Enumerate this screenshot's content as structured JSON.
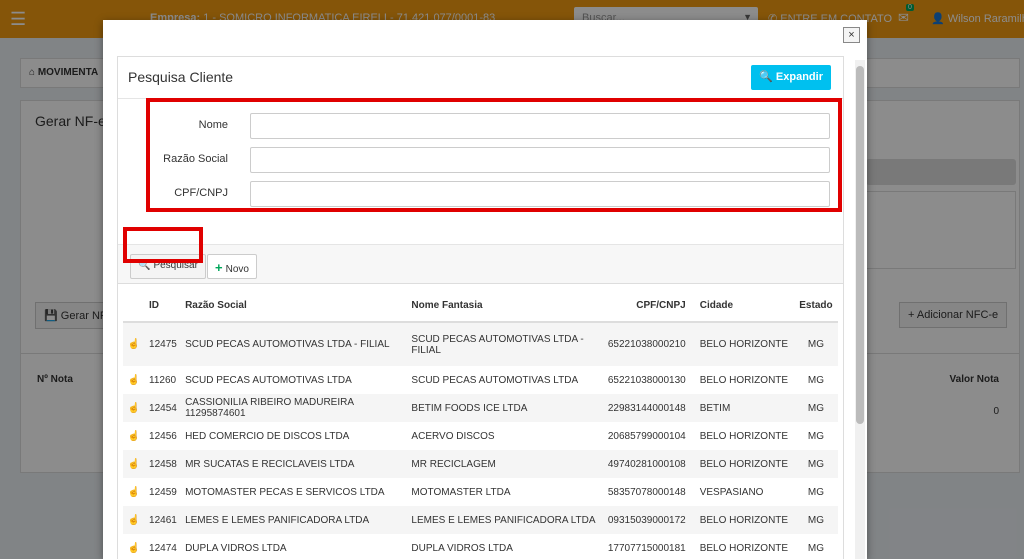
{
  "topbar": {
    "empresa_label": "Empresa:",
    "empresa_value": "1 - SOMICRO INFORMATICA EIRELI - 71.421.077/0001-83",
    "search_placeholder": "Buscar...",
    "contato": "ENTRE EM CONTATO",
    "notif_count": "0",
    "user": "Wilson Raramilho"
  },
  "background": {
    "breadcrumb": "MOVIMENTA",
    "box_title": "Gerar NF-e a",
    "btn_gerar": "Gerar NF-",
    "btn_add": "Adicionar NFC-e",
    "col_nnota": "Nº Nota",
    "col_valor": "Valor Nota",
    "valor_zero": "0"
  },
  "modal": {
    "close_label": "×",
    "title": "Pesquisa Cliente",
    "btn_expandir": "Expandir",
    "fields": {
      "nome_label": "Nome",
      "razao_label": "Razão Social",
      "cpf_label": "CPF/CNPJ"
    },
    "btn_pesquisar": "Pesquisar",
    "btn_novo": "Novo",
    "table": {
      "headers": {
        "id": "ID",
        "razao": "Razão Social",
        "fantasia": "Nome Fantasia",
        "cpf": "CPF/CNPJ",
        "cidade": "Cidade",
        "estado": "Estado"
      },
      "rows": [
        {
          "id": "12475",
          "razao": "SCUD PECAS AUTOMOTIVAS LTDA - FILIAL",
          "fantasia": "SCUD PECAS AUTOMOTIVAS LTDA - FILIAL",
          "cpf": "65221038000210",
          "cidade": "BELO HORIZONTE",
          "uf": "MG"
        },
        {
          "id": "11260",
          "razao": "SCUD PECAS AUTOMOTIVAS LTDA",
          "fantasia": "SCUD PECAS AUTOMOTIVAS LTDA",
          "cpf": "65221038000130",
          "cidade": "BELO HORIZONTE",
          "uf": "MG"
        },
        {
          "id": "12454",
          "razao": "CASSIONILIA RIBEIRO MADUREIRA 11295874601",
          "fantasia": "BETIM FOODS ICE LTDA",
          "cpf": "22983144000148",
          "cidade": "BETIM",
          "uf": "MG"
        },
        {
          "id": "12456",
          "razao": "HED COMERCIO DE DISCOS LTDA",
          "fantasia": "ACERVO DISCOS",
          "cpf": "20685799000104",
          "cidade": "BELO HORIZONTE",
          "uf": "MG"
        },
        {
          "id": "12458",
          "razao": "MR SUCATAS E RECICLAVEIS LTDA",
          "fantasia": "MR RECICLAGEM",
          "cpf": "49740281000108",
          "cidade": "BELO HORIZONTE",
          "uf": "MG"
        },
        {
          "id": "12459",
          "razao": "MOTOMASTER PECAS E SERVICOS LTDA",
          "fantasia": "MOTOMASTER LTDA",
          "cpf": "58357078000148",
          "cidade": "VESPASIANO",
          "uf": "MG"
        },
        {
          "id": "12461",
          "razao": "LEMES E LEMES PANIFICADORA LTDA",
          "fantasia": "LEMES E LEMES PANIFICADORA LTDA",
          "cpf": "09315039000172",
          "cidade": "BELO HORIZONTE",
          "uf": "MG"
        },
        {
          "id": "12474",
          "razao": "DUPLA VIDROS LTDA",
          "fantasia": "DUPLA VIDROS LTDA",
          "cpf": "17707715000181",
          "cidade": "BELO HORIZONTE",
          "uf": "MG"
        }
      ]
    }
  }
}
